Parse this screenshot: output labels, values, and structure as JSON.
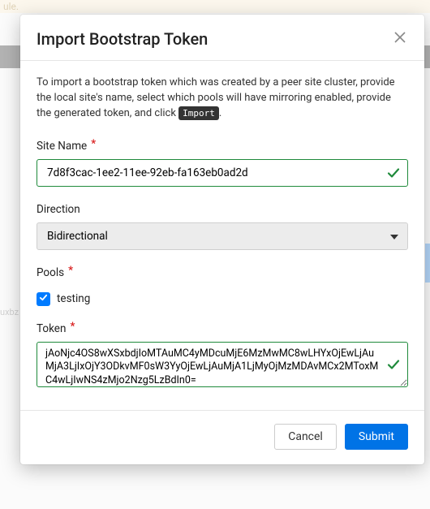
{
  "backdrop": {
    "notice_suffix": "ule.",
    "side_text": "uxbz"
  },
  "modal": {
    "title": "Import Bootstrap Token",
    "description_pre": "To import a bootstrap token which was created by a peer site cluster, provide the local site's name, select which pools will have mirroring enabled, provide the generated token, and click ",
    "description_code": "Import",
    "description_post": "."
  },
  "form": {
    "site_name": {
      "label": "Site Name",
      "value": "7d8f3cac-1ee2-11ee-92eb-fa163eb0ad2d"
    },
    "direction": {
      "label": "Direction",
      "value": "Bidirectional"
    },
    "pools": {
      "label": "Pools",
      "items": [
        {
          "name": "testing",
          "checked": true
        }
      ]
    },
    "token": {
      "label": "Token",
      "value": "jAoNjc4OS8wXSxbdjIoMTAuMC4yMDcuMjE6MzMwMC8wLHYxOjEwLjAuMjA3LjIxOjY3ODkvMF0sW3YyOjEwLjAuMjA1LjMyOjMzMDAvMCx2MToxMC4wLjIwNS4zMjo2Nzg5LzBdIn0="
    }
  },
  "footer": {
    "cancel": "Cancel",
    "submit": "Submit"
  }
}
